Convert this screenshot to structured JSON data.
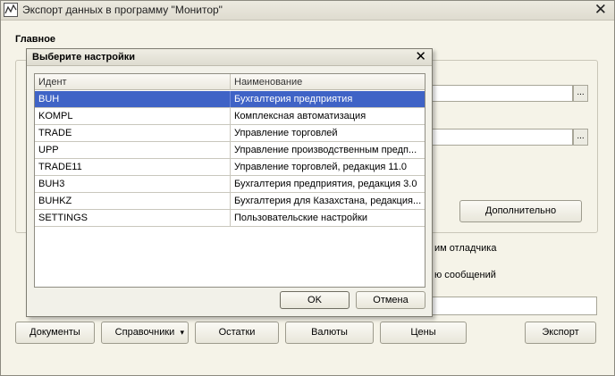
{
  "window": {
    "title": "Экспорт данных в программу \"Монитор\"",
    "close_glyph": "✕"
  },
  "main": {
    "section_title": "Главное",
    "field_button_glyph": "...",
    "additional_button": "Дополнительно",
    "partial_text_1": "им отладчика",
    "partial_text_2": "ю сообщений"
  },
  "toolbar": {
    "documents": "Документы",
    "directories": "Справочники",
    "directories_arrow": "▾",
    "balances": "Остатки",
    "currencies": "Валюты",
    "prices": "Цены",
    "export": "Экспорт"
  },
  "dialog": {
    "title": "Выберите настройки",
    "close_glyph": "✕",
    "columns": [
      "Идент",
      "Наименование"
    ],
    "rows": [
      {
        "id": "BUH",
        "name": "Бухгалтерия предприятия",
        "selected": true
      },
      {
        "id": "KOMPL",
        "name": "Комплексная автоматизация",
        "selected": false
      },
      {
        "id": "TRADE",
        "name": "Управление торговлей",
        "selected": false
      },
      {
        "id": "UPP",
        "name": "Управление производственным предп...",
        "selected": false
      },
      {
        "id": "TRADE11",
        "name": "Управление торговлей, редакция 11.0",
        "selected": false
      },
      {
        "id": "BUH3",
        "name": "Бухгалтерия предприятия, редакция 3.0",
        "selected": false
      },
      {
        "id": "BUHKZ",
        "name": "Бухгалтерия для Казахстана, редакция...",
        "selected": false
      },
      {
        "id": "SETTINGS",
        "name": "Пользовательские настройки",
        "selected": false
      }
    ],
    "ok": "OK",
    "cancel": "Отмена"
  },
  "colors": {
    "selection": "#3f63c6",
    "window_bg": "#f5f3e8"
  }
}
